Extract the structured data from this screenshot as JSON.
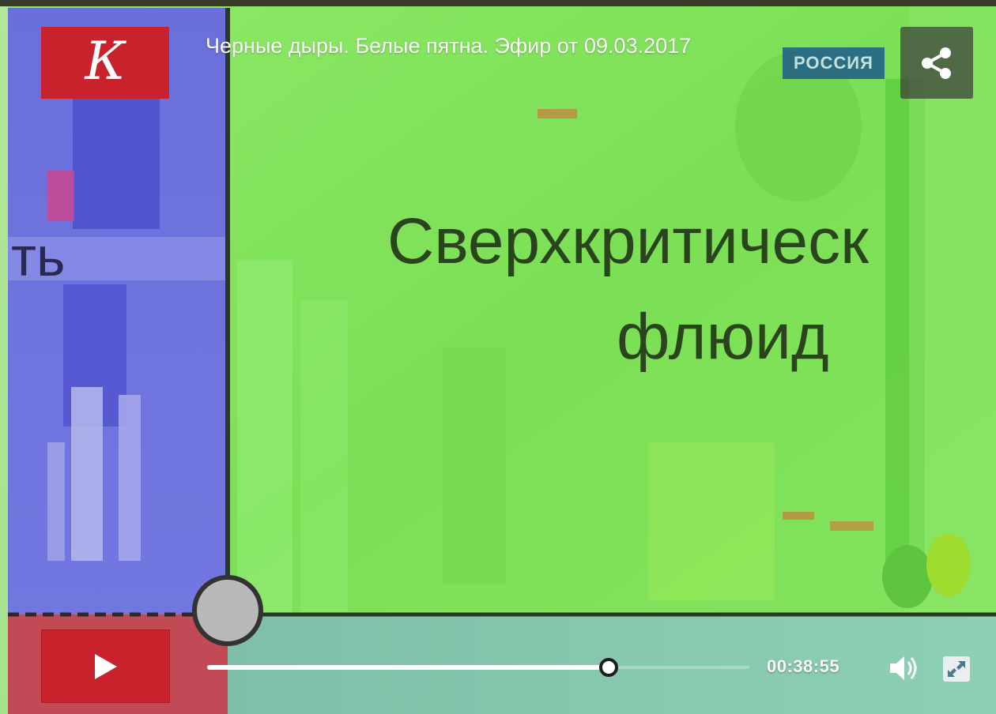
{
  "video": {
    "title": "Черные дыры. Белые пятна. Эфир от 09.03.2017",
    "channel_logo_letter": "К",
    "channel_watermark": "РОССИЯ",
    "frame_caption_line1": "Сверхкритическ",
    "frame_caption_line2": "флюид",
    "frame_caption_left": "ть"
  },
  "controls": {
    "current_time": "00:38:55",
    "progress_fraction": 0.74
  },
  "icons": {
    "share": "share-icon",
    "play": "play-icon",
    "volume": "volume-icon",
    "fullscreen": "fullscreen-icon"
  },
  "colors": {
    "brand_red": "#c8232c",
    "frame_green": "#7fe55a",
    "frame_blue": "#6b6fe0"
  }
}
